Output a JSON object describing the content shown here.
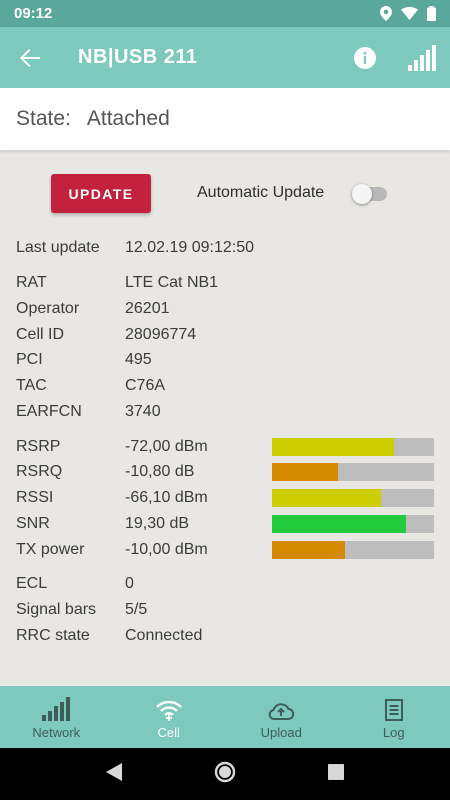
{
  "status_bar": {
    "time": "09:12"
  },
  "app_bar": {
    "title": "NB|USB 211"
  },
  "state": {
    "label": "State:",
    "value": "Attached"
  },
  "controls": {
    "update_label": "UPDATE",
    "auto_update_label": "Automatic Update",
    "auto_update_enabled": false
  },
  "last_update": {
    "label": "Last update",
    "value": "12.02.19 09:12:50"
  },
  "info": [
    {
      "label": "RAT",
      "value": "LTE Cat NB1"
    },
    {
      "label": "Operator",
      "value": "26201"
    },
    {
      "label": "Cell ID",
      "value": "28096774"
    },
    {
      "label": "PCI",
      "value": "495"
    },
    {
      "label": "TAC",
      "value": "C76A"
    },
    {
      "label": "EARFCN",
      "value": "3740"
    }
  ],
  "metrics": [
    {
      "label": "RSRP",
      "value": "-72,00 dBm",
      "level": 0.75,
      "color": "#ccce00"
    },
    {
      "label": "RSRQ",
      "value": "-10,80 dB",
      "level": 0.41,
      "color": "#d38a00"
    },
    {
      "label": "RSSI",
      "value": "-66,10 dBm",
      "level": 0.67,
      "color": "#ccce00"
    },
    {
      "label": "SNR",
      "value": "19,30 dB",
      "level": 0.83,
      "color": "#22cc3a"
    },
    {
      "label": "TX power",
      "value": "-10,00 dBm",
      "level": 0.45,
      "color": "#d38a00"
    }
  ],
  "extra": [
    {
      "label": "ECL",
      "value": "0"
    },
    {
      "label": "Signal bars",
      "value": "5/5"
    },
    {
      "label": "RRC state",
      "value": "Connected"
    }
  ],
  "bottom_nav": [
    {
      "label": "Network",
      "icon": "network-bars-icon",
      "active": false
    },
    {
      "label": "Cell",
      "icon": "wifi-cell-icon",
      "active": true
    },
    {
      "label": "Upload",
      "icon": "cloud-upload-icon",
      "active": false
    },
    {
      "label": "Log",
      "icon": "log-document-icon",
      "active": false
    }
  ],
  "colors": {
    "app_bar": "#7dc9bd",
    "status_bar": "#5aa89b",
    "accent_button": "#c4213f",
    "background": "#e9e7e3"
  }
}
